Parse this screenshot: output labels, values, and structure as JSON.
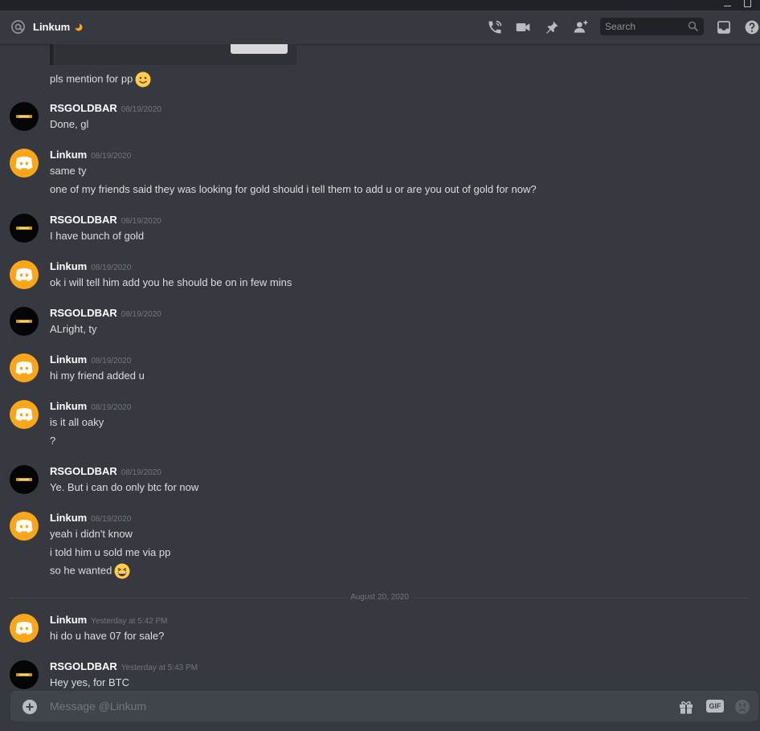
{
  "header": {
    "channel_name": "Linkum",
    "search_placeholder": "Search",
    "icons": [
      "at-icon",
      "moon-status-icon",
      "call-icon",
      "video-icon",
      "pin-icon",
      "add-friend-icon",
      "search-icon",
      "inbox-icon",
      "help-icon"
    ]
  },
  "messages": [
    {
      "type": "continuation",
      "lines": [
        "pls mention for pp"
      ],
      "emoji": "slightly-smiling-face"
    },
    {
      "author": "RSGOLDBAR",
      "timestamp": "08/19/2020",
      "avatar": "gold",
      "lines": [
        "Done, gl"
      ]
    },
    {
      "author": "Linkum",
      "timestamp": "08/19/2020",
      "avatar": "discord",
      "lines": [
        "same ty",
        "one of my friends said they was looking for gold should i tell them to add u or are you out of gold for now?"
      ]
    },
    {
      "author": "RSGOLDBAR",
      "timestamp": "08/19/2020",
      "avatar": "gold",
      "lines": [
        "I have bunch of gold"
      ]
    },
    {
      "author": "Linkum",
      "timestamp": "08/19/2020",
      "avatar": "discord",
      "lines": [
        "ok i will tell him add you he should be on in few mins"
      ]
    },
    {
      "author": "RSGOLDBAR",
      "timestamp": "08/19/2020",
      "avatar": "gold",
      "lines": [
        "ALright, ty"
      ]
    },
    {
      "author": "Linkum",
      "timestamp": "08/19/2020",
      "avatar": "discord",
      "lines": [
        "hi my friend added u"
      ]
    },
    {
      "author": "Linkum",
      "timestamp": "08/19/2020",
      "avatar": "discord",
      "lines": [
        "is it all oaky",
        "?"
      ]
    },
    {
      "author": "RSGOLDBAR",
      "timestamp": "08/19/2020",
      "avatar": "gold",
      "lines": [
        "Ye. But i can do only btc for now"
      ]
    },
    {
      "author": "Linkum",
      "timestamp": "08/19/2020",
      "avatar": "discord",
      "lines": [
        "yeah i didn't know",
        "i told him u sold me via pp",
        "so he wanted"
      ],
      "emoji": "grinning-squinting-face"
    },
    {
      "author": "Linkum",
      "timestamp": "Yesterday at 5:42 PM",
      "avatar": "discord",
      "lines": [
        "hi do u have 07 for sale?"
      ]
    },
    {
      "author": "RSGOLDBAR",
      "timestamp": "Yesterday at 5:43 PM",
      "avatar": "gold",
      "lines": [
        "Hey yes, for BTC"
      ]
    }
  ],
  "date_divider": "August 20, 2020",
  "composer": {
    "placeholder": "Message @Linkum",
    "gif_label": "GIF"
  },
  "colors": {
    "background": "#36393f",
    "titlebar": "#202225",
    "composer": "#40444b",
    "discord_avatar": "#faa61a",
    "timestamp": "#72767d"
  }
}
